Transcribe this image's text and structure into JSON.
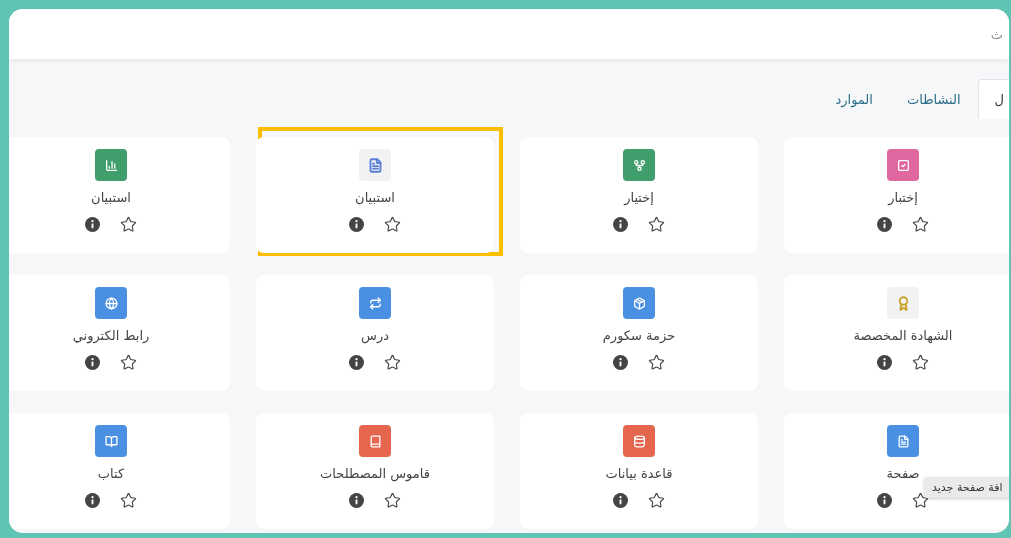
{
  "search": {
    "placeholder": "ث"
  },
  "tabs": [
    {
      "label": "ل",
      "selected": true
    },
    {
      "label": "النشاطات",
      "selected": false
    },
    {
      "label": "الموارد",
      "selected": false
    }
  ],
  "cards": [
    {
      "title": "إختبار",
      "kind": "solid",
      "color": "#e0679f",
      "highlighted": false
    },
    {
      "title": "إختيار",
      "kind": "solid",
      "color": "#3f9e6b",
      "highlighted": false
    },
    {
      "title": "استبيان",
      "kind": "light",
      "color": "#5b7fd6",
      "highlighted": true
    },
    {
      "title": "استبيان",
      "kind": "solid",
      "color": "#3f9e6b",
      "highlighted": false
    },
    {
      "title": "الشهادة المخصصة",
      "kind": "light",
      "color": "#c9a227",
      "highlighted": false
    },
    {
      "title": "حزمة سكورم",
      "kind": "solid",
      "color": "#4a90e2",
      "highlighted": false
    },
    {
      "title": "درس",
      "kind": "solid",
      "color": "#4a90e2",
      "highlighted": false
    },
    {
      "title": "رابط الكتروني",
      "kind": "solid",
      "color": "#4a90e2",
      "highlighted": false
    },
    {
      "title": "صفحة",
      "kind": "solid",
      "color": "#4a90e2",
      "highlighted": false,
      "tooltip": "افة صفحة جديد"
    },
    {
      "title": "قاعدة بيانات",
      "kind": "solid",
      "color": "#e5654e",
      "highlighted": false
    },
    {
      "title": "قاموس المصطلحات",
      "kind": "solid",
      "color": "#e5654e",
      "highlighted": false
    },
    {
      "title": "كتاب",
      "kind": "solid",
      "color": "#4a90e2",
      "highlighted": false
    }
  ]
}
